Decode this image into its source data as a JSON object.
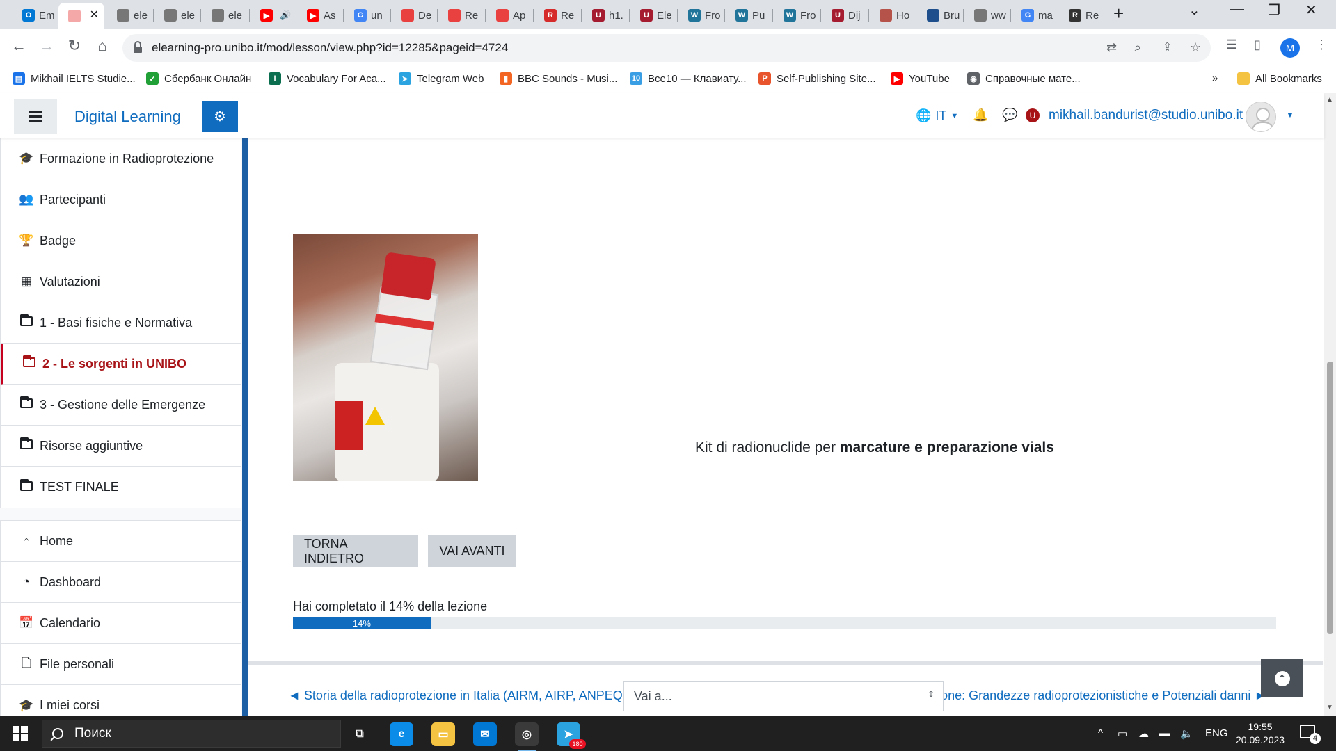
{
  "browser": {
    "tabs": [
      {
        "title": "Em",
        "color": "#0078d4",
        "glyph": "O"
      },
      {
        "title": "",
        "color": "#f4a9a8",
        "glyph": "",
        "active": true
      },
      {
        "title": "ele",
        "color": "#777777",
        "glyph": ""
      },
      {
        "title": "ele",
        "color": "#777777",
        "glyph": ""
      },
      {
        "title": "ele",
        "color": "#777777",
        "glyph": ""
      },
      {
        "title": "",
        "color": "#ff0000",
        "glyph": "▶",
        "audio": true
      },
      {
        "title": "As",
        "color": "#ff0000",
        "glyph": "▶"
      },
      {
        "title": "un",
        "color": "#4285f4",
        "glyph": "G"
      },
      {
        "title": "De",
        "color": "#e94040",
        "glyph": ""
      },
      {
        "title": "Re",
        "color": "#e94040",
        "glyph": ""
      },
      {
        "title": "Ap",
        "color": "#e94040",
        "glyph": ""
      },
      {
        "title": "Re",
        "color": "#d62b2b",
        "glyph": "R"
      },
      {
        "title": "h1.",
        "color": "#a51c30",
        "glyph": "U"
      },
      {
        "title": "Ele",
        "color": "#a51c30",
        "glyph": "U"
      },
      {
        "title": "Fro",
        "color": "#21759b",
        "glyph": "W"
      },
      {
        "title": "Pu",
        "color": "#21759b",
        "glyph": "W"
      },
      {
        "title": "Fro",
        "color": "#21759b",
        "glyph": "W"
      },
      {
        "title": "Dij",
        "color": "#a51c30",
        "glyph": "U"
      },
      {
        "title": "Ho",
        "color": "#b5524a",
        "glyph": ""
      },
      {
        "title": "Bru",
        "color": "#1e4f8c",
        "glyph": ""
      },
      {
        "title": "ww",
        "color": "#777777",
        "glyph": ""
      },
      {
        "title": "ma",
        "color": "#4285f4",
        "glyph": "G"
      },
      {
        "title": "Re",
        "color": "#333333",
        "glyph": "R"
      }
    ],
    "url": "elearning-pro.unibo.it/mod/lesson/view.php?id=12285&pageid=4724",
    "profile_initial": "M",
    "bookmarks": [
      {
        "label": "Mikhail IELTS Studie...",
        "color": "#1a73e8",
        "glyph": "▤"
      },
      {
        "label": "Сбербанк Онлайн",
        "color": "#21a038",
        "glyph": "✓"
      },
      {
        "label": "Vocabulary For Aca...",
        "color": "#0b6e4f",
        "glyph": "I"
      },
      {
        "label": "Telegram Web",
        "color": "#2aa3e0",
        "glyph": "➤"
      },
      {
        "label": "BBC Sounds - Musi...",
        "color": "#f26522",
        "glyph": "▮"
      },
      {
        "label": "Все10 — Клавиату...",
        "color": "#3a9ee4",
        "glyph": "10"
      },
      {
        "label": "Self-Publishing Site...",
        "color": "#e8552d",
        "glyph": "P"
      },
      {
        "label": "YouTube",
        "color": "#ff0000",
        "glyph": "▶"
      },
      {
        "label": "Справочные мате...",
        "color": "#5f6368",
        "glyph": "◉"
      }
    ],
    "all_bookmarks": "All Bookmarks"
  },
  "moodle": {
    "site_name": "Digital Learning",
    "language": "IT",
    "user_email": "mikhail.bandurist@studio.unibo.it",
    "course_nav": [
      {
        "label": "Formazione in Radioprotezione",
        "icon": "graduation-cap-icon",
        "glyph": "🎓"
      },
      {
        "label": "Partecipanti",
        "icon": "users-icon",
        "glyph": "👥"
      },
      {
        "label": "Badge",
        "icon": "trophy-icon",
        "glyph": "🏆"
      },
      {
        "label": "Valutazioni",
        "icon": "table-icon",
        "glyph": "▦"
      },
      {
        "label": "1 - Basi fisiche e Normativa",
        "icon": "folder-icon"
      },
      {
        "label": "2 - Le sorgenti in UNIBO",
        "icon": "folder-icon",
        "active": true
      },
      {
        "label": "3 - Gestione delle Emergenze",
        "icon": "folder-icon"
      },
      {
        "label": "Risorse aggiuntive",
        "icon": "folder-icon"
      },
      {
        "label": "TEST FINALE",
        "icon": "folder-icon"
      }
    ],
    "site_nav": [
      {
        "label": "Home",
        "icon": "home-icon",
        "glyph": "⌂"
      },
      {
        "label": "Dashboard",
        "icon": "dashboard-icon",
        "glyph": "◔"
      },
      {
        "label": "Calendario",
        "icon": "calendar-icon",
        "glyph": "📅"
      },
      {
        "label": "File personali",
        "icon": "file-icon",
        "glyph": "🗋"
      },
      {
        "label": "I miei corsi",
        "icon": "graduation-cap-icon",
        "glyph": "🎓"
      }
    ],
    "lesson": {
      "caption_prefix": "Kit di radionuclide per ",
      "caption_bold": "marcature e preparazione vials",
      "back_button": "TORNA INDIETRO",
      "next_button": "VAI AVANTI",
      "progress_text": "Hai completato il 14% della lezione",
      "progress_percent": 14,
      "progress_label": "14%",
      "prev_link": "◄ Storia della radioprotezione in Italia (AIRM, AIRP, ANPEQ)",
      "jump_placeholder": "Vai a...",
      "next_link": "Appunti di Radioprotezione: Grandezze radioprotezionistiche e Potenziali danni ►"
    }
  },
  "taskbar": {
    "search_label": "Поиск",
    "apps": [
      {
        "name": "task-view",
        "color": "#202020",
        "glyph": "⧉"
      },
      {
        "name": "edge",
        "color": "#0c8ce9",
        "glyph": "e"
      },
      {
        "name": "file-explorer",
        "color": "#f5c342",
        "glyph": "▭"
      },
      {
        "name": "mail",
        "color": "#0078d4",
        "glyph": "✉"
      },
      {
        "name": "chrome",
        "color": "#3a3a3a",
        "glyph": "◎",
        "active": true
      },
      {
        "name": "telegram",
        "color": "#2aa3e0",
        "glyph": "➤",
        "badge": "180"
      }
    ],
    "language": "ENG",
    "time": "19:55",
    "date": "20.09.2023",
    "notifications": "4"
  }
}
